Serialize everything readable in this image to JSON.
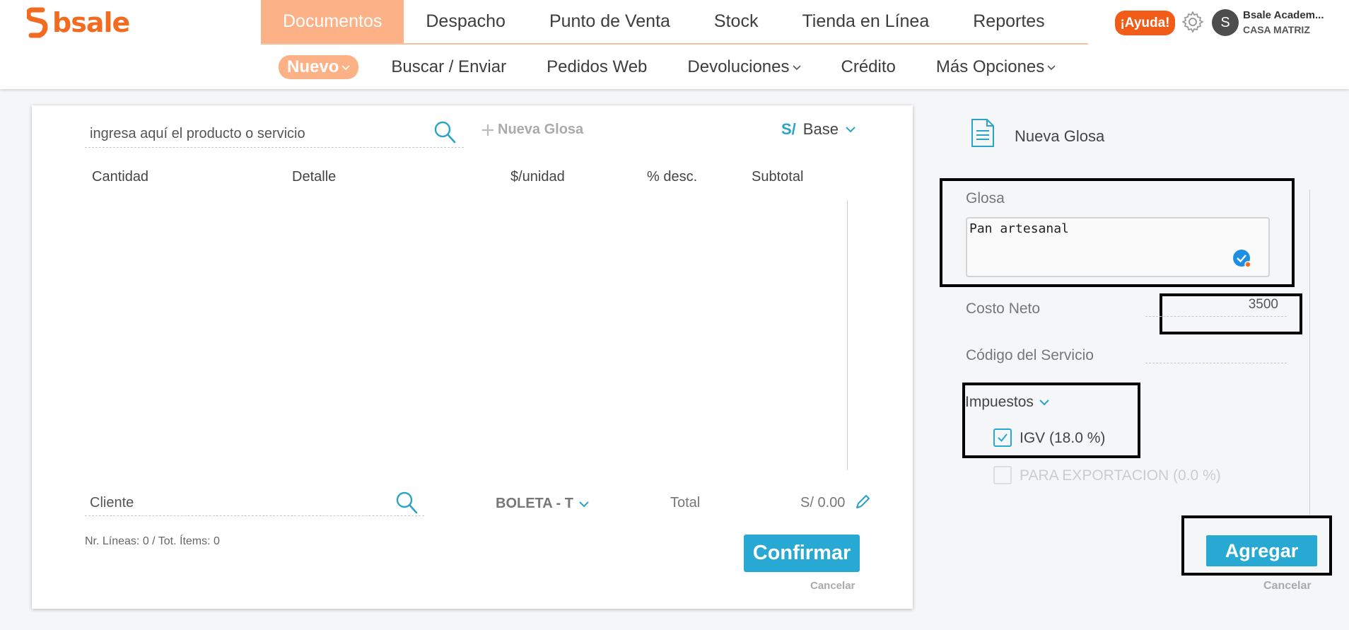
{
  "brand": {
    "name": "bsale",
    "color": "#f26b21"
  },
  "main_nav": [
    {
      "label": "Documentos",
      "active": true
    },
    {
      "label": "Despacho"
    },
    {
      "label": "Punto de Venta"
    },
    {
      "label": "Stock"
    },
    {
      "label": "Tienda en Línea"
    },
    {
      "label": "Reportes"
    }
  ],
  "header": {
    "help_label": "¡Ayuda!",
    "avatar_initial": "S",
    "account_name": "Bsale Academ...",
    "account_branch": "CASA MATRIZ"
  },
  "sub_nav": [
    {
      "label": "Nuevo",
      "active": true,
      "dropdown": true
    },
    {
      "label": "Buscar / Enviar"
    },
    {
      "label": "Pedidos Web"
    },
    {
      "label": "Devoluciones",
      "dropdown": true
    },
    {
      "label": "Crédito"
    },
    {
      "label": "Más Opciones",
      "dropdown": true
    }
  ],
  "document": {
    "product_search_placeholder": "ingresa aquí el producto o servicio",
    "new_gloss_link": "Nueva Glosa",
    "currency_symbol": "S/",
    "price_list": "Base",
    "columns": {
      "quantity": "Cantidad",
      "detail": "Detalle",
      "unit_price": "$/unidad",
      "discount": "% desc.",
      "subtotal": "Subtotal"
    },
    "client_placeholder": "Cliente",
    "document_type": "BOLETA - T",
    "total_label": "Total",
    "total_value": "S/ 0.00",
    "lines_info": "Nr. Líneas: 0 / Tot. Ítems: 0",
    "confirm_label": "Confirmar",
    "cancel_label": "Cancelar"
  },
  "gloss_panel": {
    "title": "Nueva Glosa",
    "gloss_label": "Glosa",
    "gloss_value": "Pan artesanal",
    "net_cost_label": "Costo Neto",
    "net_cost_value": "3500",
    "service_code_label": "Código del Servicio",
    "service_code_value": "",
    "taxes_label": "Impuestos",
    "taxes": [
      {
        "label": "IGV (18.0 %)",
        "checked": true,
        "enabled": true
      },
      {
        "label": "PARA EXPORTACION (0.0 %)",
        "checked": false,
        "enabled": false
      }
    ],
    "add_label": "Agregar",
    "cancel_label": "Cancelar"
  },
  "colors": {
    "accent_orange": "#fcb286",
    "help_orange": "#f25c19",
    "primary_blue": "#28a9d3"
  }
}
